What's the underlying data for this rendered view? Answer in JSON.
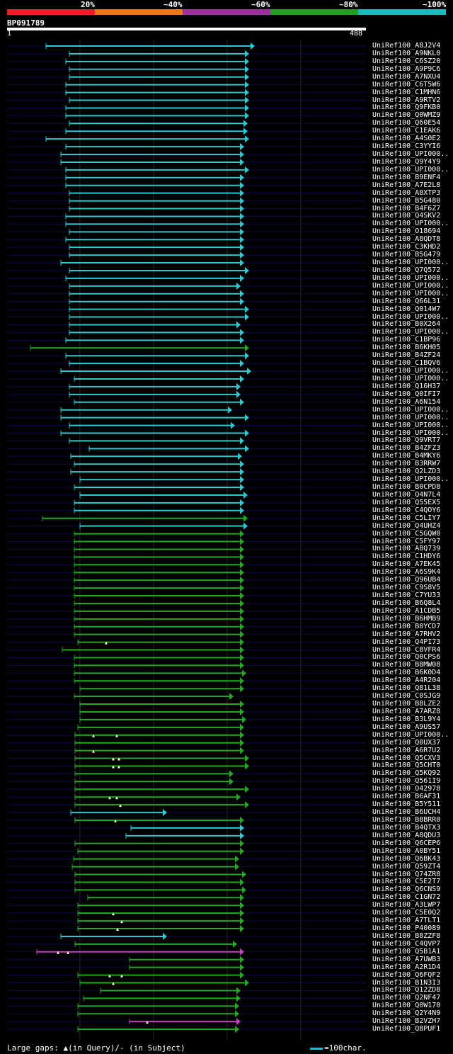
{
  "scale": {
    "labels": [
      "20%",
      "~40%",
      "~60%",
      "~80%",
      "~100%"
    ],
    "colors": [
      "#e8202a",
      "#e87a1c",
      "#a030a0",
      "#20a020",
      "#20b8c0"
    ]
  },
  "query": {
    "name": "BP091789",
    "start": "1",
    "end": "488"
  },
  "colors": {
    "cyan": "#2ec8d0",
    "green": "#22a822",
    "magenta": "#c040c0",
    "grid": "#2a2a2a",
    "rowline": "#0a0a50"
  },
  "hits": [
    {
      "label": "UniRef100_A8J2V4",
      "start": 65,
      "end": 360,
      "color": "cyan"
    },
    {
      "label": "UniRef100_A9NKL0",
      "start": 98,
      "end": 352,
      "color": "cyan"
    },
    {
      "label": "UniRef100_C6SZ20",
      "start": 93,
      "end": 352,
      "color": "cyan"
    },
    {
      "label": "UniRef100_A9P9C6",
      "start": 98,
      "end": 352,
      "color": "cyan"
    },
    {
      "label": "UniRef100_A7NXU4",
      "start": 98,
      "end": 352,
      "color": "cyan"
    },
    {
      "label": "UniRef100_C6T5W6",
      "start": 93,
      "end": 352,
      "color": "cyan"
    },
    {
      "label": "UniRef100_C1MHN6",
      "start": 93,
      "end": 352,
      "color": "cyan"
    },
    {
      "label": "UniRef100_A9RTV2",
      "start": 98,
      "end": 352,
      "color": "cyan"
    },
    {
      "label": "UniRef100_Q9FKB0",
      "start": 93,
      "end": 352,
      "color": "cyan"
    },
    {
      "label": "UniRef100_Q0WMZ9",
      "start": 93,
      "end": 352,
      "color": "cyan"
    },
    {
      "label": "UniRef100_Q60E54",
      "start": 98,
      "end": 350,
      "color": "cyan"
    },
    {
      "label": "UniRef100_C1EAK6",
      "start": 93,
      "end": 350,
      "color": "cyan"
    },
    {
      "label": "UniRef100_A4S0E2",
      "start": 65,
      "end": 352,
      "color": "cyan"
    },
    {
      "label": "UniRef100_C3YYI6",
      "start": 93,
      "end": 345,
      "color": "cyan"
    },
    {
      "label": "UniRef100_UPI000..",
      "start": 86,
      "end": 345,
      "color": "cyan"
    },
    {
      "label": "UniRef100_Q9Y4Y9",
      "start": 86,
      "end": 345,
      "color": "cyan"
    },
    {
      "label": "UniRef100_UPI000..",
      "start": 93,
      "end": 352,
      "color": "cyan"
    },
    {
      "label": "UniRef100_B9ENF4",
      "start": 93,
      "end": 345,
      "color": "cyan"
    },
    {
      "label": "UniRef100_A7E2L8",
      "start": 93,
      "end": 345,
      "color": "cyan"
    },
    {
      "label": "UniRef100_A8XTP3",
      "start": 98,
      "end": 345,
      "color": "cyan"
    },
    {
      "label": "UniRef100_B5G480",
      "start": 98,
      "end": 345,
      "color": "cyan"
    },
    {
      "label": "UniRef100_B4F6Z7",
      "start": 98,
      "end": 345,
      "color": "cyan"
    },
    {
      "label": "UniRef100_Q4SKV2",
      "start": 93,
      "end": 345,
      "color": "cyan"
    },
    {
      "label": "UniRef100_UPI000..",
      "start": 93,
      "end": 345,
      "color": "cyan"
    },
    {
      "label": "UniRef100_O18694",
      "start": 98,
      "end": 345,
      "color": "cyan"
    },
    {
      "label": "UniRef100_A8QDT8",
      "start": 93,
      "end": 345,
      "color": "cyan"
    },
    {
      "label": "UniRef100_C3KHD2",
      "start": 98,
      "end": 345,
      "color": "cyan"
    },
    {
      "label": "UniRef100_B5G479",
      "start": 98,
      "end": 345,
      "color": "cyan"
    },
    {
      "label": "UniRef100_UPI000..",
      "start": 86,
      "end": 345,
      "color": "cyan"
    },
    {
      "label": "UniRef100_Q7Q572",
      "start": 98,
      "end": 352,
      "color": "cyan"
    },
    {
      "label": "UniRef100_UPI000..",
      "start": 93,
      "end": 345,
      "color": "cyan"
    },
    {
      "label": "UniRef100_UPI000..",
      "start": 98,
      "end": 340,
      "color": "cyan"
    },
    {
      "label": "UniRef100_UPI000..",
      "start": 98,
      "end": 345,
      "color": "cyan"
    },
    {
      "label": "UniRef100_Q66L31",
      "start": 98,
      "end": 345,
      "color": "cyan"
    },
    {
      "label": "UniRef100_Q014W7",
      "start": 98,
      "end": 352,
      "color": "cyan"
    },
    {
      "label": "UniRef100_UPI000..",
      "start": 98,
      "end": 352,
      "color": "cyan"
    },
    {
      "label": "UniRef100_B0X264",
      "start": 98,
      "end": 340,
      "color": "cyan"
    },
    {
      "label": "UniRef100_UPI000..",
      "start": 98,
      "end": 345,
      "color": "cyan"
    },
    {
      "label": "UniRef100_C1BP96",
      "start": 93,
      "end": 345,
      "color": "cyan"
    },
    {
      "label": "UniRef100_B6KH05",
      "start": 43,
      "end": 352,
      "color": "green"
    },
    {
      "label": "UniRef100_B4ZF24",
      "start": 93,
      "end": 352,
      "color": "cyan"
    },
    {
      "label": "UniRef100_C1BQV6",
      "start": 98,
      "end": 345,
      "color": "cyan"
    },
    {
      "label": "UniRef100_UPI000..",
      "start": 86,
      "end": 355,
      "color": "cyan"
    },
    {
      "label": "UniRef100_UPI000..",
      "start": 105,
      "end": 345,
      "color": "cyan"
    },
    {
      "label": "UniRef100_Q16H37",
      "start": 98,
      "end": 340,
      "color": "cyan"
    },
    {
      "label": "UniRef100_Q0IFI7",
      "start": 98,
      "end": 340,
      "color": "cyan"
    },
    {
      "label": "UniRef100_A6N154",
      "start": 105,
      "end": 345,
      "color": "cyan"
    },
    {
      "label": "UniRef100_UPI000..",
      "start": 86,
      "end": 328,
      "color": "cyan"
    },
    {
      "label": "UniRef100_UPI000..",
      "start": 86,
      "end": 352,
      "color": "cyan"
    },
    {
      "label": "UniRef100_UPI000..",
      "start": 98,
      "end": 332,
      "color": "cyan"
    },
    {
      "label": "UniRef100_UPI000..",
      "start": 86,
      "end": 352,
      "color": "cyan"
    },
    {
      "label": "UniRef100_Q9VRT7",
      "start": 98,
      "end": 345,
      "color": "cyan"
    },
    {
      "label": "UniRef100_B4ZFZ3",
      "start": 126,
      "end": 352,
      "color": "cyan"
    },
    {
      "label": "UniRef100_B4MKY6",
      "start": 100,
      "end": 342,
      "color": "cyan"
    },
    {
      "label": "UniRef100_B3RRW7",
      "start": 105,
      "end": 345,
      "color": "cyan"
    },
    {
      "label": "UniRef100_Q2LZD3",
      "start": 100,
      "end": 345,
      "color": "cyan"
    },
    {
      "label": "UniRef100_UPI000..",
      "start": 113,
      "end": 345,
      "color": "cyan"
    },
    {
      "label": "UniRef100_B0CPD8",
      "start": 105,
      "end": 345,
      "color": "cyan"
    },
    {
      "label": "UniRef100_Q4N7L4",
      "start": 113,
      "end": 350,
      "color": "cyan"
    },
    {
      "label": "UniRef100_Q55EX5",
      "start": 105,
      "end": 345,
      "color": "cyan"
    },
    {
      "label": "UniRef100_C4QOY6",
      "start": 105,
      "end": 345,
      "color": "cyan"
    },
    {
      "label": "UniRef100_C5LIY7",
      "start": 60,
      "end": 350,
      "color": "green"
    },
    {
      "label": "UniRef100_Q4UHZ4",
      "start": 113,
      "end": 350,
      "color": "cyan"
    },
    {
      "label": "UniRef100_C5GQW0",
      "start": 105,
      "end": 345,
      "color": "green"
    },
    {
      "label": "UniRef100_C5FY97",
      "start": 105,
      "end": 345,
      "color": "green"
    },
    {
      "label": "UniRef100_A8Q739",
      "start": 105,
      "end": 345,
      "color": "green"
    },
    {
      "label": "UniRef100_C1HDY6",
      "start": 105,
      "end": 345,
      "color": "green"
    },
    {
      "label": "UniRef100_A7EK45",
      "start": 105,
      "end": 345,
      "color": "green"
    },
    {
      "label": "UniRef100_A6S9K4",
      "start": 105,
      "end": 345,
      "color": "green"
    },
    {
      "label": "UniRef100_Q96UB4",
      "start": 105,
      "end": 345,
      "color": "green"
    },
    {
      "label": "UniRef100_C9S8V5",
      "start": 105,
      "end": 345,
      "color": "green"
    },
    {
      "label": "UniRef100_C7YU33",
      "start": 105,
      "end": 345,
      "color": "green"
    },
    {
      "label": "UniRef100_B6Q8L4",
      "start": 105,
      "end": 345,
      "color": "green"
    },
    {
      "label": "UniRef100_A1CDB5",
      "start": 105,
      "end": 345,
      "color": "green"
    },
    {
      "label": "UniRef100_B6HMB9",
      "start": 105,
      "end": 345,
      "color": "green"
    },
    {
      "label": "UniRef100_B0YCD7",
      "start": 105,
      "end": 345,
      "color": "green"
    },
    {
      "label": "UniRef100_A7RHV2",
      "start": 105,
      "end": 345,
      "color": "green"
    },
    {
      "label": "UniRef100_Q4PI73",
      "start": 110,
      "end": 345,
      "color": "green",
      "tri": [
        150
      ]
    },
    {
      "label": "UniRef100_C8VFR4",
      "start": 88,
      "end": 345,
      "color": "green"
    },
    {
      "label": "UniRef100_Q0CPS6",
      "start": 105,
      "end": 345,
      "color": "green"
    },
    {
      "label": "UniRef100_B8MW08",
      "start": 105,
      "end": 345,
      "color": "green"
    },
    {
      "label": "UniRef100_B6K0D4",
      "start": 105,
      "end": 348,
      "color": "green"
    },
    {
      "label": "UniRef100_A4R204",
      "start": 105,
      "end": 345,
      "color": "green"
    },
    {
      "label": "UniRef100_Q81L38",
      "start": 113,
      "end": 345,
      "color": "green"
    },
    {
      "label": "UniRef100_C0SJG9",
      "start": 105,
      "end": 330,
      "color": "green"
    },
    {
      "label": "UniRef100_B8LZE2",
      "start": 113,
      "end": 345,
      "color": "green"
    },
    {
      "label": "UniRef100_A7ARZ8",
      "start": 113,
      "end": 345,
      "color": "green"
    },
    {
      "label": "UniRef100_B3L9Y4",
      "start": 113,
      "end": 348,
      "color": "green"
    },
    {
      "label": "UniRef100_A9US57",
      "start": 110,
      "end": 345,
      "color": "green"
    },
    {
      "label": "UniRef100_UPI000..",
      "start": 106,
      "end": 345,
      "color": "green",
      "tri": [
        132,
        165
      ]
    },
    {
      "label": "UniRef100_Q0UX37",
      "start": 106,
      "end": 345,
      "color": "green"
    },
    {
      "label": "UniRef100_A6R7U2",
      "start": 106,
      "end": 345,
      "color": "green",
      "tri": [
        132
      ]
    },
    {
      "label": "UniRef100_Q5CXV3",
      "start": 106,
      "end": 352,
      "color": "green",
      "tri": [
        160,
        168
      ]
    },
    {
      "label": "UniRef100_Q5CHT0",
      "start": 106,
      "end": 352,
      "color": "green",
      "tri": [
        160,
        168
      ]
    },
    {
      "label": "UniRef100_Q5KQ92",
      "start": 106,
      "end": 330,
      "color": "green"
    },
    {
      "label": "UniRef100_Q561I9",
      "start": 106,
      "end": 330,
      "color": "green"
    },
    {
      "label": "UniRef100_O42978",
      "start": 106,
      "end": 352,
      "color": "green"
    },
    {
      "label": "UniRef100_B6AF31",
      "start": 106,
      "end": 340,
      "color": "green",
      "tri": [
        155,
        165
      ]
    },
    {
      "label": "UniRef100_B5Y511",
      "start": 106,
      "end": 352,
      "color": "green",
      "tri": [
        170
      ]
    },
    {
      "label": "UniRef100_B6UCH4",
      "start": 100,
      "end": 236,
      "color": "cyan"
    },
    {
      "label": "UniRef100_B8BRR0",
      "start": 106,
      "end": 345,
      "color": "green",
      "tri": [
        163
      ]
    },
    {
      "label": "UniRef100_B4QTX3",
      "start": 185,
      "end": 345,
      "color": "cyan"
    },
    {
      "label": "UniRef100_A8QDU3",
      "start": 178,
      "end": 345,
      "color": "cyan"
    },
    {
      "label": "UniRef100_Q6CEP6",
      "start": 106,
      "end": 345,
      "color": "green"
    },
    {
      "label": "UniRef100_A0BY51",
      "start": 110,
      "end": 345,
      "color": "green"
    },
    {
      "label": "UniRef100_Q6BK43",
      "start": 104,
      "end": 338,
      "color": "green"
    },
    {
      "label": "UniRef100_Q59ZT4",
      "start": 102,
      "end": 338,
      "color": "green"
    },
    {
      "label": "UniRef100_Q74ZR8",
      "start": 106,
      "end": 348,
      "color": "green"
    },
    {
      "label": "UniRef100_C5E2T7",
      "start": 106,
      "end": 345,
      "color": "green"
    },
    {
      "label": "UniRef100_Q6CNS9",
      "start": 106,
      "end": 348,
      "color": "green"
    },
    {
      "label": "UniRef100_C1GN72",
      "start": 124,
      "end": 345,
      "color": "green"
    },
    {
      "label": "UniRef100_A3LWP7",
      "start": 110,
      "end": 345,
      "color": "green"
    },
    {
      "label": "UniRef100_C5E0Q2",
      "start": 110,
      "end": 345,
      "color": "green",
      "tri": [
        160
      ]
    },
    {
      "label": "UniRef100_A7TLT1",
      "start": 110,
      "end": 345,
      "color": "green",
      "tri": [
        172
      ]
    },
    {
      "label": "UniRef100_P40089",
      "start": 110,
      "end": 345,
      "color": "green",
      "tri": [
        166
      ]
    },
    {
      "label": "UniRef100_B8ZZF8",
      "start": 86,
      "end": 236,
      "color": "cyan"
    },
    {
      "label": "UniRef100_C4QVP7",
      "start": 106,
      "end": 335,
      "color": "green"
    },
    {
      "label": "UniRef100_Q5B1A1",
      "start": 52,
      "end": 345,
      "color": "magenta",
      "tri": [
        82,
        96
      ]
    },
    {
      "label": "UniRef100_A7UWB3",
      "start": 183,
      "end": 345,
      "color": "green"
    },
    {
      "label": "UniRef100_A2R1D4",
      "start": 183,
      "end": 345,
      "color": "green"
    },
    {
      "label": "UniRef100_Q6FQF2",
      "start": 110,
      "end": 345,
      "color": "green",
      "tri": [
        155,
        172
      ]
    },
    {
      "label": "UniRef100_B1N3I3",
      "start": 113,
      "end": 352,
      "color": "green",
      "tri": [
        160
      ]
    },
    {
      "label": "UniRef100_Q12ZD8",
      "start": 142,
      "end": 340,
      "color": "green"
    },
    {
      "label": "UniRef100_Q2NF47",
      "start": 118,
      "end": 340,
      "color": "green"
    },
    {
      "label": "UniRef100_Q0W170",
      "start": 110,
      "end": 338,
      "color": "green"
    },
    {
      "label": "UniRef100_Q2Y4N9",
      "start": 110,
      "end": 338,
      "color": "green"
    },
    {
      "label": "UniRef100_B2VZH7",
      "start": 183,
      "end": 340,
      "color": "magenta",
      "tri": [
        208
      ]
    },
    {
      "label": "UniRef100_Q8PUF1",
      "start": 110,
      "end": 338,
      "color": "green"
    }
  ],
  "footer": "Large gaps: ▲(in Query)/- (in Subject)",
  "legend": "=100char."
}
